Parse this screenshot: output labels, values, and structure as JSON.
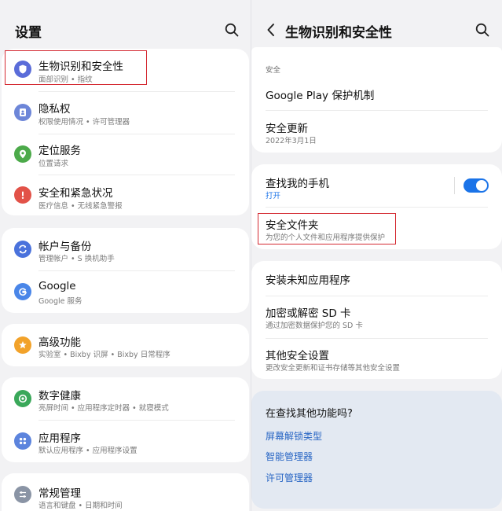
{
  "left": {
    "title": "设置",
    "items": [
      {
        "label": "生物识别和安全性",
        "sub": "面部识别 • 指纹",
        "icon": "shield-icon",
        "color": "#5a6cd9"
      },
      {
        "label": "隐私权",
        "sub": "权限使用情况 • 许可管理器",
        "icon": "privacy-icon",
        "color": "#6d86d8"
      },
      {
        "label": "定位服务",
        "sub": "位置请求",
        "icon": "location-icon",
        "color": "#4caa4a"
      },
      {
        "label": "安全和紧急状况",
        "sub": "医疗信息 • 无线紧急警报",
        "icon": "emergency-icon",
        "color": "#e25248"
      },
      {
        "label": "帐户与备份",
        "sub": "管理帐户 • S 换机助手",
        "icon": "sync-icon",
        "color": "#4a72dc"
      },
      {
        "label": "Google",
        "sub": "Google 服务",
        "icon": "google-icon",
        "color": "#4a86e8"
      },
      {
        "label": "高级功能",
        "sub": "实验室 • Bixby 识屏 • Bixby 日常程序",
        "icon": "star-icon",
        "color": "#f2a22a"
      },
      {
        "label": "数字健康",
        "sub": "亮屏时间 • 应用程序定时器 • 就寝模式",
        "icon": "wellbeing-icon",
        "color": "#3aa85a"
      },
      {
        "label": "应用程序",
        "sub": "默认应用程序 • 应用程序设置",
        "icon": "apps-icon",
        "color": "#5c84dd"
      },
      {
        "label": "常规管理",
        "sub": "语言和键盘 • 日期和时间",
        "icon": "sliders-icon",
        "color": "#8a94a5"
      }
    ]
  },
  "right": {
    "title": "生物识别和安全性",
    "section_label": "安全",
    "items": [
      {
        "label": "Google Play 保护机制",
        "sub": ""
      },
      {
        "label": "安全更新",
        "sub": "2022年3月1日"
      },
      {
        "label": "查找我的手机",
        "sub": "打开",
        "toggle_on": true
      },
      {
        "label": "安全文件夹",
        "sub": "为您的个人文件和应用程序提供保护"
      },
      {
        "label": "安装未知应用程序",
        "sub": ""
      },
      {
        "label": "加密或解密 SD 卡",
        "sub": "通过加密数据保护您的 SD 卡"
      },
      {
        "label": "其他安全设置",
        "sub": "更改安全更新和证书存储等其他安全设置"
      }
    ],
    "suggest_title": "在查找其他功能吗?",
    "suggest_links": [
      "屏幕解锁类型",
      "智能管理器",
      "许可管理器"
    ]
  },
  "colors": {
    "accent": "#1a73e8",
    "link": "#2765c4",
    "highlight": "#d42a32"
  }
}
